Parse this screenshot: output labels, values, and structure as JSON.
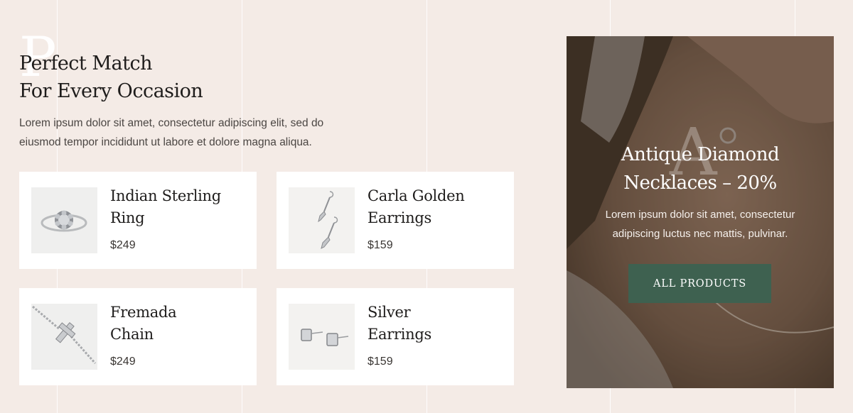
{
  "section": {
    "ghost_letter": "P",
    "heading_line1": "Perfect Match",
    "heading_line2": "For Every Occasion",
    "intro": "Lorem ipsum dolor sit amet, consectetur adipiscing elit, sed do eiusmod tempor incididunt ut labore et dolore magna aliqua."
  },
  "products": [
    {
      "name_line1": "Indian Sterling",
      "name_line2": "Ring",
      "price": "$249",
      "icon": "ring-icon"
    },
    {
      "name_line1": "Carla Golden",
      "name_line2": "Earrings",
      "price": "$159",
      "icon": "drop-earrings-icon"
    },
    {
      "name_line1": "Fremada",
      "name_line2": "Chain",
      "price": "$249",
      "icon": "cross-chain-icon"
    },
    {
      "name_line1": "Silver",
      "name_line2": "Earrings",
      "price": "$159",
      "icon": "stud-earrings-icon"
    }
  ],
  "promo": {
    "ghost_letter": "A",
    "title_line1": "Antique Diamond",
    "title_line2": "Necklaces – 20%",
    "description": "Lorem ipsum dolor sit amet, consectetur adipiscing luctus nec mattis, pulvinar.",
    "button_label": "ALL PRODUCTS"
  },
  "colors": {
    "background": "#f4ebe6",
    "card": "#ffffff",
    "heading": "#1e1c1b",
    "button": "#3e6150",
    "promo_overlay": "#6b5a4c"
  }
}
